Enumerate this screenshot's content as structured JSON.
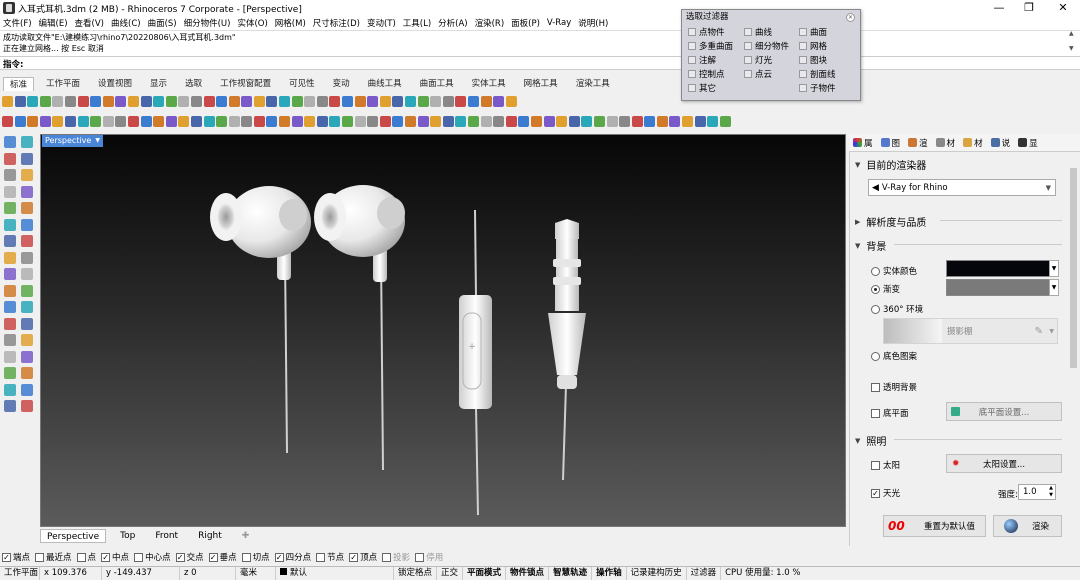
{
  "window": {
    "title": "入耳式耳机.3dm (2 MB) - Rhinoceros 7 Corporate - [Perspective]",
    "min": "—",
    "max": "❐",
    "close": "✕"
  },
  "menu": [
    "文件(F)",
    "编辑(E)",
    "查看(V)",
    "曲线(C)",
    "曲面(S)",
    "细分物件(U)",
    "实体(O)",
    "网格(M)",
    "尺寸标注(D)",
    "变动(T)",
    "工具(L)",
    "分析(A)",
    "渲染(R)",
    "面板(P)",
    "V-Ray",
    "说明(H)"
  ],
  "command_history": [
    "成功读取文件\"E:\\建模练习\\rhino7\\20220806\\入耳式耳机.3dm\"",
    "正在建立网格... 按 Esc 取消"
  ],
  "command_prompt": "指令:",
  "toolbar_tabs": [
    "标准",
    "工作平面",
    "设置视图",
    "显示",
    "选取",
    "工作视窗配置",
    "可见性",
    "变动",
    "曲线工具",
    "曲面工具",
    "实体工具",
    "网格工具",
    "渲染工具"
  ],
  "select_filter": {
    "title": "选取过滤器",
    "col1": [
      "点物件",
      "多重曲面",
      "注解",
      "控制点",
      "其它"
    ],
    "col2": [
      "曲线",
      "细分物件",
      "灯光",
      "点云"
    ],
    "col3": [
      "曲面",
      "网格",
      "图块",
      "剖面线",
      "子物件"
    ]
  },
  "viewport": {
    "name": "Perspective",
    "tabs": [
      "Perspective",
      "Top",
      "Front",
      "Right"
    ],
    "add_tab": "✚"
  },
  "osnap": [
    {
      "label": "端点",
      "checked": true,
      "dim": false
    },
    {
      "label": "最近点",
      "checked": false,
      "dim": false
    },
    {
      "label": "点",
      "checked": false,
      "dim": false
    },
    {
      "label": "中点",
      "checked": true,
      "dim": false
    },
    {
      "label": "中心点",
      "checked": false,
      "dim": false
    },
    {
      "label": "交点",
      "checked": true,
      "dim": false
    },
    {
      "label": "垂点",
      "checked": true,
      "dim": false
    },
    {
      "label": "切点",
      "checked": false,
      "dim": false
    },
    {
      "label": "四分点",
      "checked": true,
      "dim": false
    },
    {
      "label": "节点",
      "checked": false,
      "dim": false
    },
    {
      "label": "顶点",
      "checked": true,
      "dim": false
    },
    {
      "label": "投影",
      "checked": false,
      "dim": true
    },
    {
      "label": "停用",
      "checked": false,
      "dim": true
    }
  ],
  "status": {
    "cplane": "工作平面",
    "x": "x 109.376",
    "y": "y -149.437",
    "z": "z 0",
    "unit": "毫米",
    "layer": "默认",
    "lock_grid": "锁定格点",
    "ortho": "正交",
    "planar": "平面模式",
    "osnap": "物件锁点",
    "smarttrack": "智慧轨迹",
    "gumball": "操作轴",
    "history": "记录建构历史",
    "filter": "过滤器",
    "cpu": "CPU 使用量: 1.0 %"
  },
  "panel": {
    "tabs": [
      "属",
      "图",
      "渲",
      "材",
      "材",
      "说",
      "显"
    ],
    "target_renderer_label": "目前的渲染器",
    "renderer": "V-Ray for Rhino",
    "resolution_label": "解析度与品质",
    "background_label": "背景",
    "bg_solid": "实体颜色",
    "bg_gradient": "渐变",
    "bg_360": "360° 环境",
    "bg_360_value": "摄影棚",
    "bg_wallpaper": "底色图案",
    "transparent_bg": "透明背景",
    "ground_plane": "底平面",
    "ground_plane_btn": "底平面设置...",
    "lighting_label": "照明",
    "sun": "太阳",
    "sun_btn": "太阳设置...",
    "skylight": "天光",
    "intensity_label": "强度:",
    "intensity_value": "1.0",
    "reset_btn": "重置为默认值",
    "render_btn": "渲染",
    "reset_icon": "00",
    "colors": {
      "solid": "#05050c",
      "gradient": "#7a7a7a"
    }
  }
}
